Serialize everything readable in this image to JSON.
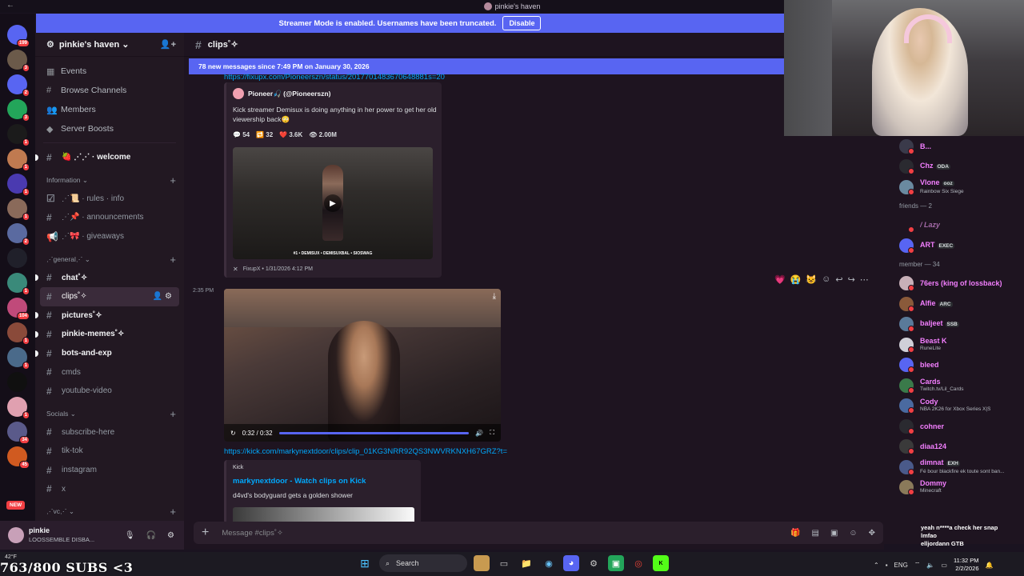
{
  "window": {
    "title": "pinkie's haven"
  },
  "banner": {
    "text": "Streamer Mode is enabled. Usernames have been truncated.",
    "button": "Disable"
  },
  "rail": {
    "servers": [
      {
        "color": "#5865f2",
        "badge": "199"
      },
      {
        "color": "#6b5a4a",
        "badge": "3"
      },
      {
        "color": "#5865f2",
        "badge": "2"
      },
      {
        "color": "#23a55a",
        "badge": "3"
      },
      {
        "color": "#1b1b1b",
        "badge": "1"
      },
      {
        "color": "#c07a50",
        "badge": "1"
      },
      {
        "color": "#4a3ab0",
        "badge": "1"
      },
      {
        "color": "#8a6a5a",
        "badge": "1"
      },
      {
        "color": "#5a6aa0",
        "badge": "2"
      },
      {
        "color": "#20202a",
        "badge": ""
      },
      {
        "color": "#3a8a7a",
        "badge": "1"
      },
      {
        "color": "#c04a7a",
        "badge": "104"
      },
      {
        "color": "#8a4a3a",
        "badge": "1"
      },
      {
        "color": "#4a6a8a",
        "badge": "1"
      },
      {
        "color": "#101010",
        "badge": ""
      },
      {
        "color": "#e0a0b0",
        "badge": "1"
      },
      {
        "color": "#5a5a8a",
        "badge": "34"
      },
      {
        "color": "#d05a20",
        "badge": "45"
      }
    ],
    "new_label": "NEW"
  },
  "sidebar": {
    "server_name": "pinkie's haven ⌄",
    "top_items": [
      "Events",
      "Browse Channels",
      "Members",
      "Server Boosts"
    ],
    "welcome": "🍓 ⋰⋰ · welcome",
    "cat_information": "Information ⌄",
    "info_channels": [
      "⋰📜 · rules · info",
      "⋰📌 · announcements",
      "⋰🎀 · giveaways"
    ],
    "cat_general": "⋰general⋰ ⌄",
    "general_channels": [
      {
        "name": "chat˚✧",
        "unread": true
      },
      {
        "name": "clips˚✧",
        "unread": false,
        "selected": true
      },
      {
        "name": "pictures˚✧",
        "unread": true
      },
      {
        "name": "pinkie-memes˚✧",
        "unread": true
      },
      {
        "name": "bots-and-exp",
        "unread": true
      },
      {
        "name": "cmds",
        "unread": false
      },
      {
        "name": "youtube-video",
        "unread": false
      }
    ],
    "cat_socials": "Socials ⌄",
    "social_channels": [
      "subscribe-here",
      "tik-tok",
      "instagram",
      "x"
    ],
    "cat_vc": "⋰vc⋰ ⌄"
  },
  "user": {
    "name": "pinkie",
    "status": "LOOSSEMBLE DISBA..."
  },
  "chat": {
    "channel": "clips˚✧",
    "new_messages": "78 new messages since 7:49 PM on January 30, 2026",
    "top_link": "https://fixupx.com/Pioneerszn/status/2017701483670648881s=20",
    "embed1": {
      "author": "Pioneer🎣 (@Pioneerszn)",
      "desc": "Kick streamer Demisux is doing anything in her power to get her old viewership back😳",
      "replies": "54",
      "retweets": "32",
      "likes": "3.6K",
      "views": "2.00M",
      "footer": "FixupX • 1/31/2026 4:12 PM",
      "caption": "#1 • DEMISUX • DEMISUXBAL • SIOSWAG"
    },
    "msg_time": "2:35 PM",
    "video": {
      "time": "0:32 / 0:32",
      "progress": 1.0
    },
    "kick_link": "https://kick.com/markynextdoor/clips/clip_01KG3NRR92QS3NWVRKNXH67GRZ?t=",
    "embed2": {
      "provider": "Kick",
      "title": "markynextdoor - Watch clips on Kick",
      "desc": "d4vd's bodyguard gets a golden shower"
    },
    "composer_placeholder": "Message #clips˚✧"
  },
  "members": {
    "partial": [
      {
        "name": "B...",
        "tag": "",
        "act": "",
        "color": "#3a3a4a"
      },
      {
        "name": "Chz",
        "tag": "ODA",
        "act": "",
        "color": "#2a2a30"
      },
      {
        "name": "Vlone",
        "tag": "ooz",
        "act": "Rainbow Six Siege",
        "color": "#6a8aa0"
      }
    ],
    "friends_header": "friends — 2",
    "friends": [
      {
        "name": "/ Lazy",
        "tag": "",
        "act": "",
        "color": "#1e1420",
        "dim": true
      },
      {
        "name": "ART",
        "tag": "EXEC",
        "act": "",
        "color": "#5865f2",
        "dim": false
      }
    ],
    "member_header": "member — 34",
    "list": [
      {
        "name": "76ers (king of lossback)",
        "tag": "",
        "act": "",
        "color": "#c8b0b8"
      },
      {
        "name": "Alfie",
        "tag": "ARC",
        "act": "",
        "color": "#8a5a3a"
      },
      {
        "name": "baljeet",
        "tag": "SSB",
        "act": "",
        "color": "#5a7a9a"
      },
      {
        "name": "Beast K",
        "tag": "",
        "act": "RuneLite",
        "color": "#d0d0d8"
      },
      {
        "name": "bleed",
        "tag": "",
        "act": "",
        "color": "#5865f2"
      },
      {
        "name": "Cards",
        "tag": "",
        "act": "Twitch.tv/Lil_Cards",
        "color": "#3a7a4a"
      },
      {
        "name": "Cody",
        "tag": "",
        "act": "NBA 2K26 for Xbox Series X|S",
        "color": "#4a6aa0"
      },
      {
        "name": "cohner",
        "tag": "",
        "act": "",
        "color": "#2a2a30"
      },
      {
        "name": "diaa124",
        "tag": "",
        "act": "",
        "color": "#3a3a3a"
      },
      {
        "name": "dimnat",
        "tag": "EXH",
        "act": "Fé bour blackfire ek toute sont ban...",
        "color": "#4a5a8a"
      },
      {
        "name": "Dommy",
        "tag": "",
        "act": "Minecraft",
        "color": "#8a7a5a"
      }
    ]
  },
  "overlay_chat": [
    "yeah n****a check her snap",
    "lmfao",
    "elljordann GTB"
  ],
  "taskbar": {
    "weather": "42°F",
    "subs": "763/800 SUBS <3",
    "search": "Search",
    "lang": "ENG",
    "time": "11:32 PM",
    "date": "2/2/2026"
  }
}
